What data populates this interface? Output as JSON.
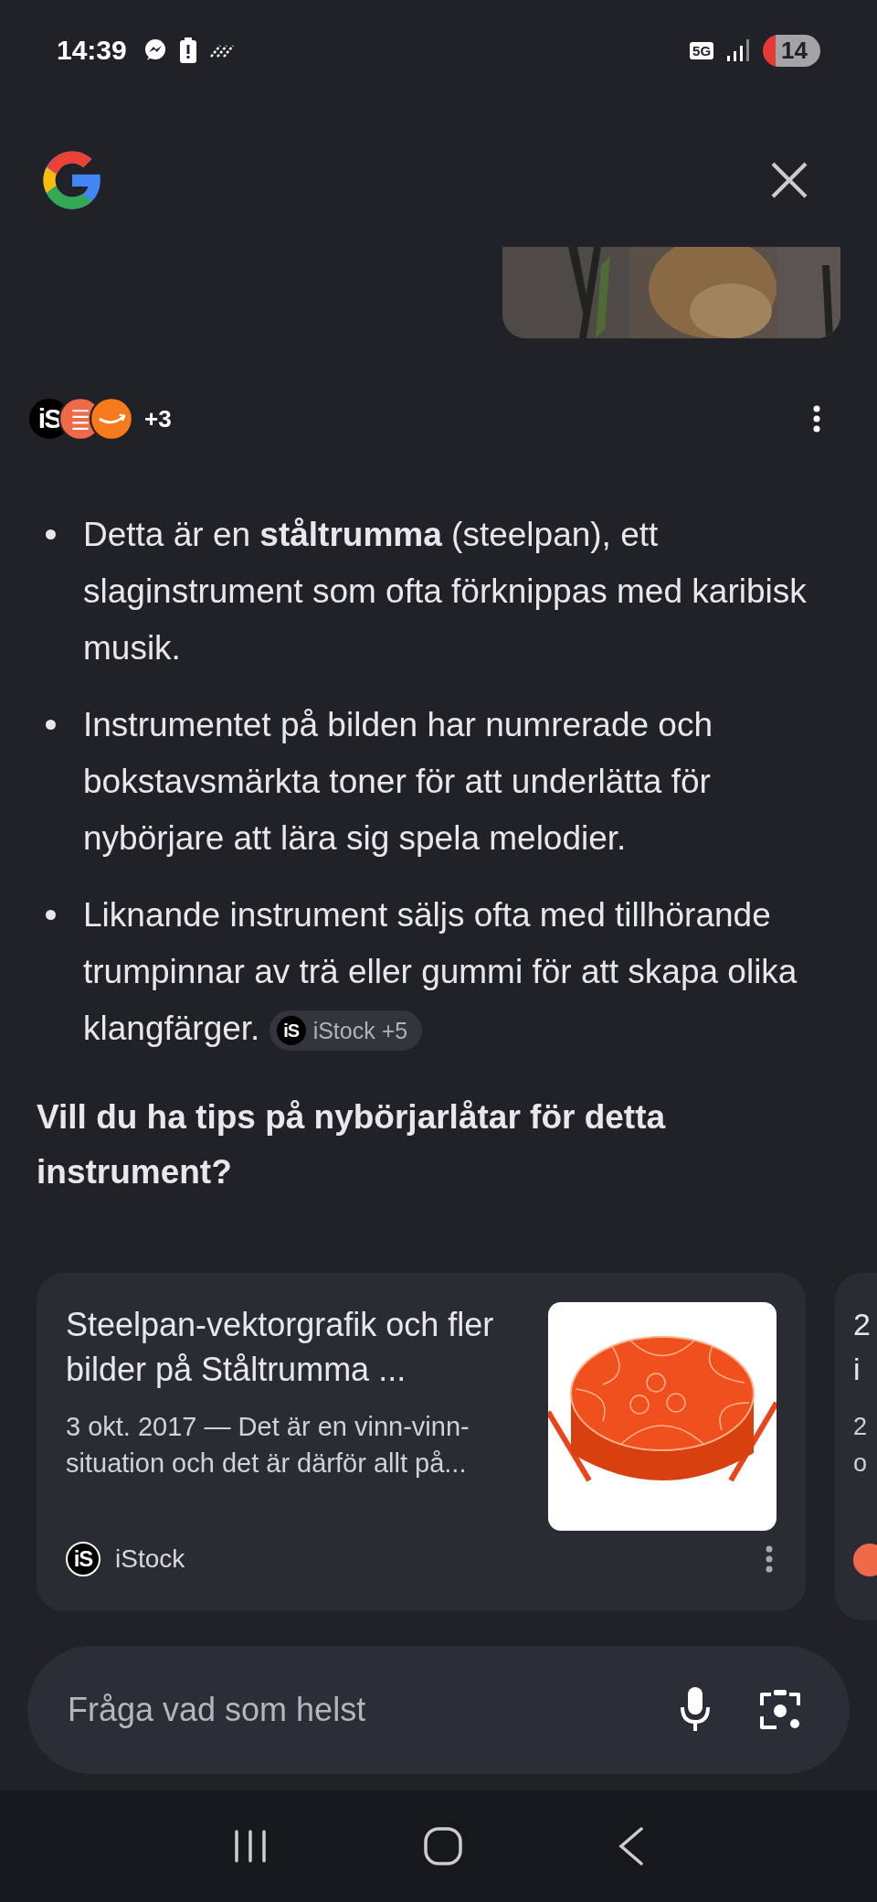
{
  "status_bar": {
    "time": "14:39",
    "network": "5G",
    "battery": "14"
  },
  "sources": {
    "logos": [
      {
        "kind": "istock",
        "text": "iS"
      },
      {
        "kind": "striped"
      },
      {
        "kind": "amazon"
      }
    ],
    "more": "+3"
  },
  "bullets": [
    {
      "text": "Detta är en **ståltrumma** (steelpan), ett slaginstrument som ofta förknippas med karibisk musik."
    },
    {
      "text": "Instrumentet på bilden har numrerade och bokstavsmärkta toner för att underlätta för nybörjare att lära sig spela melodier."
    },
    {
      "text": "Liknande instrument säljs ofta med tillhörande trumpinnar av trä eller gummi för att skapa olika klangfärger.",
      "chip": {
        "logo": "iS",
        "label": "iStock +5"
      }
    }
  ],
  "question": "Vill du ha tips på nybörjarlåtar för detta instrument?",
  "cards": [
    {
      "title": "Steelpan-vektorgrafik och fler bilder på Ståltrumma ...",
      "snippet": "3 okt. 2017 — Det är en vinn-vinn-situation och det är därför allt på...",
      "source_logo": "iS",
      "source": "iStock"
    },
    {
      "title": "2",
      "title_2": "i",
      "snippet": "2",
      "snippet_2": "o"
    }
  ],
  "search": {
    "placeholder": "Fråga vad som helst"
  }
}
